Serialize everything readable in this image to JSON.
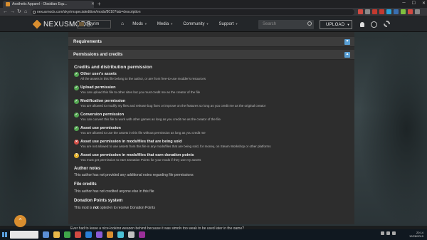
{
  "browser": {
    "tab_title": "Aesthetic Apparel - Obsidian Equ...",
    "url": "nexusmods.com/skyrimspecialedition/mods/8016?tab=description",
    "nav_icons": [
      "back-icon",
      "forward-icon",
      "reload-icon",
      "home-icon"
    ],
    "extension_colors": [
      "#d04a42",
      "#8a8a8a",
      "#c23a30",
      "#c23a30",
      "#2aa0d8",
      "#3a6fb0",
      "#7fbf3f",
      "#d04a42",
      "#888888"
    ]
  },
  "site_nav": {
    "logo_text": "NEXUSMODS",
    "game": "Skyrim",
    "items": [
      {
        "label": "Mods"
      },
      {
        "label": "Media"
      },
      {
        "label": "Community"
      },
      {
        "label": "Support"
      }
    ],
    "search_placeholder": "Search",
    "upload_label": "UPLOAD"
  },
  "sections": {
    "requirements": "Requirements",
    "permissions": "Permissions and credits"
  },
  "credits_heading": "Credits and distribution permission",
  "permissions": [
    {
      "status": "ok",
      "title": "Other user's assets",
      "desc": "All the assets in this file belong to the author, or are from free-to-use modder's resources"
    },
    {
      "status": "ok",
      "title": "Upload permission",
      "desc": "You can upload this file to other sites but you must credit me as the creator of the file"
    },
    {
      "status": "ok",
      "title": "Modification permission",
      "desc": "You are allowed to modify my files and release bug fixes or improve on the features so long as you credit me as the original creator"
    },
    {
      "status": "ok",
      "title": "Conversion permission",
      "desc": "You can convert this file to work with other games as long as you credit me as the creator of the file"
    },
    {
      "status": "ok",
      "title": "Asset use permission",
      "desc": "You are allowed to use the assets in this file without permission as long as you credit me"
    },
    {
      "status": "no",
      "title": "Asset use permission in mods/files that are being sold",
      "desc": "You are not allowed to use assets from this file in any mods/files that are being sold, for money, on Steam Workshop or other platforms"
    },
    {
      "status": "maybe",
      "title": "Asset use permission in mods/files that earn donation points",
      "desc": "You must get permission to earn Donation Points for your mods if they use my assets"
    }
  ],
  "author_notes": {
    "heading": "Author notes",
    "text": "This author has not provided any additional notes regarding file permissions"
  },
  "file_credits": {
    "heading": "File credits",
    "text": "This author has not credited anyone else in this file"
  },
  "donation": {
    "heading": "Donation Points system",
    "text_pre": "This mod is ",
    "text_bold": "not",
    "text_post": " opted-in to receive Donation Points"
  },
  "teaser": "Ever had to leave a nice-looking weapon behind because it was simply too weak to be used later in the game?",
  "taskbar": {
    "app_colors": [
      "#5b8fd6",
      "#e8b84a",
      "#3fa64a",
      "#d04a42",
      "#2a7fd6",
      "#8a5bd6",
      "#d98e2f",
      "#4ac0d6",
      "#c0c0c0",
      "#9a2f9a"
    ],
    "time": "20:14",
    "date": "12/28/2019"
  }
}
